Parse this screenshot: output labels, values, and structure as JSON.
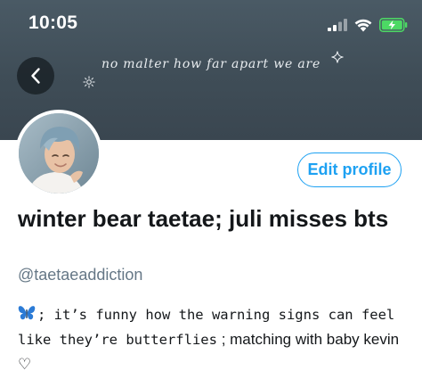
{
  "status_bar": {
    "time": "10:05"
  },
  "header": {
    "banner_text": "no malter how far apart we are"
  },
  "profile": {
    "edit_button_label": "Edit profile",
    "display_name": "winter bear taetae; juli misses bts",
    "handle": "@taetaeaddiction",
    "bio": {
      "lead_icon": "butterfly-emoji",
      "part1": "; it’s funny how the warning signs can feel like they’re butterflies",
      "part2": " ; matching with baby kevin ♡"
    }
  },
  "colors": {
    "header_bg": "#3f4d57",
    "accent": "#1da1f2",
    "handle_gray": "#657786",
    "text": "#14171a",
    "battery_green": "#4cd964"
  },
  "icons": [
    "signal-icon",
    "wifi-icon",
    "battery-charging-icon",
    "back-arrow-icon",
    "sparkle-icon",
    "sun-doodle-icon",
    "butterfly-icon"
  ]
}
